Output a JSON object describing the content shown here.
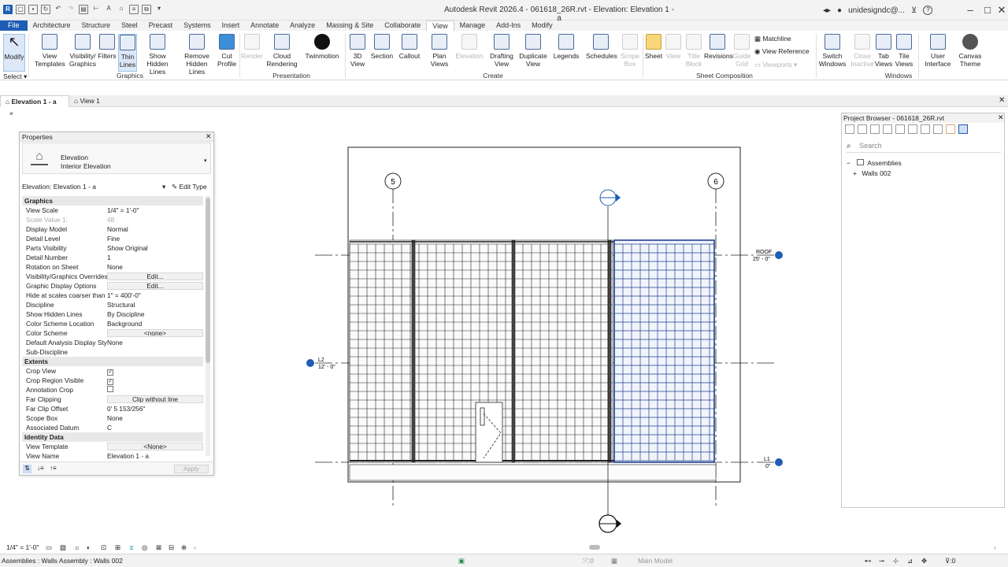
{
  "window": {
    "title": "Autodesk Revit 2026.4 - 061618_26R.rvt - Elevation: Elevation 1 - a",
    "user": "unidesigndc@...",
    "help": "?"
  },
  "ribbon_tabs": [
    "File",
    "Architecture",
    "Structure",
    "Steel",
    "Precast",
    "Systems",
    "Insert",
    "Annotate",
    "Analyze",
    "Massing & Site",
    "Collaborate",
    "View",
    "Manage",
    "Add-Ins",
    "Modify"
  ],
  "active_tab": "View",
  "ribbon": {
    "modify": "Modify",
    "select": "Select",
    "view_templates": "View Templates",
    "visibility_graphics": "Visibility/ Graphics",
    "filters": "Filters",
    "thin_lines": "Thin Lines",
    "show_hidden_lines": "Show Hidden Lines",
    "remove_hidden_lines": "Remove Hidden Lines",
    "cut_profile": "Cut Profile",
    "graphics_panel": "Graphics",
    "render": "Render",
    "cloud_rendering": "Cloud Rendering",
    "twinmotion": "Twinmotion",
    "presentation_panel": "Presentation",
    "view_3d": "3D View",
    "section": "Section",
    "callout": "Callout",
    "plan_views": "Plan Views",
    "elevation": "Elevation",
    "drafting_view": "Drafting View",
    "duplicate_view": "Duplicate View",
    "legends": "Legends",
    "schedules": "Schedules",
    "scope_box": "Scope Box",
    "create_panel": "Create",
    "sheet": "Sheet",
    "view": "View",
    "title_block": "Title Block",
    "revisions": "Revisions",
    "guide_grid": "Guide Grid",
    "matchline": "Matchline",
    "view_reference": "View Reference",
    "viewports": "Viewports",
    "sheet_composition_panel": "Sheet Composition",
    "switch_windows": "Switch Windows",
    "close_inactive": "Close Inactive",
    "tab_views": "Tab Views",
    "tile_views": "Tile Views",
    "user_interface": "User Interface",
    "windows_panel": "Windows",
    "canvas_theme": "Canvas Theme"
  },
  "view_tabs": [
    {
      "label": "Elevation 1 - a",
      "close": "×"
    },
    {
      "label": "View 1"
    }
  ],
  "properties": {
    "title": "Properties",
    "family": "Elevation",
    "type": "Interior Elevation",
    "selector": "Elevation: Elevation 1 - a",
    "edit_type": "Edit Type",
    "apply": "Apply",
    "groups": [
      {
        "name": "Graphics",
        "rows": [
          {
            "k": "View Scale",
            "v": "1/4\" = 1'-0\""
          },
          {
            "k": "Scale Value    1:",
            "v": "48",
            "dim": true
          },
          {
            "k": "Display Model",
            "v": "Normal"
          },
          {
            "k": "Detail Level",
            "v": "Fine"
          },
          {
            "k": "Parts Visibility",
            "v": "Show Original"
          },
          {
            "k": "Detail Number",
            "v": "1"
          },
          {
            "k": "Rotation on Sheet",
            "v": "None"
          },
          {
            "k": "Visibility/Graphics Overrides",
            "v": "Edit...",
            "btn": true
          },
          {
            "k": "Graphic Display Options",
            "v": "Edit...",
            "btn": true
          },
          {
            "k": "Hide at scales coarser than",
            "v": "1\" = 400'-0\""
          },
          {
            "k": "Discipline",
            "v": "Structural"
          },
          {
            "k": "Show Hidden Lines",
            "v": "By Discipline"
          },
          {
            "k": "Color Scheme Location",
            "v": "Background"
          },
          {
            "k": "Color Scheme",
            "v": "<none>",
            "btn": true
          },
          {
            "k": "Default Analysis Display Style",
            "v": "None"
          },
          {
            "k": "Sub-Discipline",
            "v": ""
          }
        ]
      },
      {
        "name": "Extents",
        "rows": [
          {
            "k": "Crop View",
            "v": "✓",
            "chk": true
          },
          {
            "k": "Crop Region Visible",
            "v": "✓",
            "chk": true
          },
          {
            "k": "Annotation Crop",
            "v": "",
            "chk": true
          },
          {
            "k": "Far Clipping",
            "v": "Clip without line",
            "btn": true
          },
          {
            "k": "Far Clip Offset",
            "v": "0'  5 153/256\""
          },
          {
            "k": "Scope Box",
            "v": "None"
          },
          {
            "k": "Associated Datum",
            "v": "C"
          }
        ]
      },
      {
        "name": "Identity Data",
        "rows": [
          {
            "k": "View Template",
            "v": "<None>",
            "btn": true
          },
          {
            "k": "View Name",
            "v": "Elevation 1 - a"
          }
        ]
      }
    ]
  },
  "project_browser": {
    "title": "Project Browser - 061618_26R.rvt",
    "search_placeholder": "Search",
    "tree": [
      {
        "label": "Assemblies",
        "toggle": "−"
      },
      {
        "label": "Walls 002",
        "toggle": "+"
      }
    ]
  },
  "drawing": {
    "grid_labels": [
      "5",
      "6"
    ],
    "levels": [
      {
        "name": "ROOF",
        "elev": "25' - 0\""
      },
      {
        "name": "L2",
        "elev": "12' - 0\""
      },
      {
        "name": "L1",
        "elev": "0\""
      }
    ],
    "colors": {
      "selected": "#1f3f8f",
      "line": "#1a1a1a",
      "marker": "#1e5db4"
    }
  },
  "view_bar": {
    "scale": "1/4\" = 1'-0\""
  },
  "status": {
    "text": "Assemblies : Walls Assembly : Walls 002",
    "model": "Main Model",
    "count": ":0"
  }
}
